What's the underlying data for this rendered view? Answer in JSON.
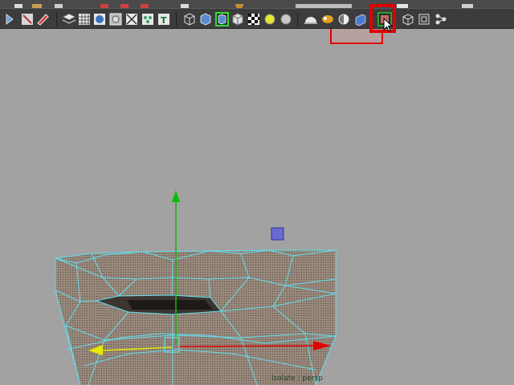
{
  "toolbar": {
    "icons": [
      "new-scene-icon",
      "open-scene-icon",
      "save-scene-icon",
      "select-tool-icon",
      "lasso-tool-icon",
      "paint-select-icon",
      "camera-attributes-icon",
      "bookmark-icon",
      "image-plane-icon",
      "grid-icon",
      "film-gate-icon",
      "resolution-gate-icon",
      "gate-mask-icon",
      "field-chart-icon",
      "safe-action-icon",
      "safe-title-icon",
      "wireframe-icon",
      "smooth-shade-icon",
      "wireframe-on-shaded-icon",
      "flat-shade-icon",
      "textured-icon",
      "use-all-lights-icon",
      "shadows-icon",
      "xray-icon",
      "xray-joints-icon",
      "backface-culling-icon",
      "isolate-select-icon",
      "ambient-occlusion-icon",
      "motion-blur-icon",
      "multisample-icon"
    ],
    "highlighted_icon": "isolate-select-icon"
  },
  "viewport": {
    "status_label": "isolate : persp"
  },
  "colors": {
    "viewport_bg": "#a2a2a2",
    "toolbar_bg": "#3c3c3c",
    "wireframe": "#62e0f0",
    "mesh_fill": "#8c7a6c",
    "highlight": "#e00000",
    "axis_x": "#e00000",
    "axis_y": "#00c000",
    "axis_z": "#e8e800"
  }
}
